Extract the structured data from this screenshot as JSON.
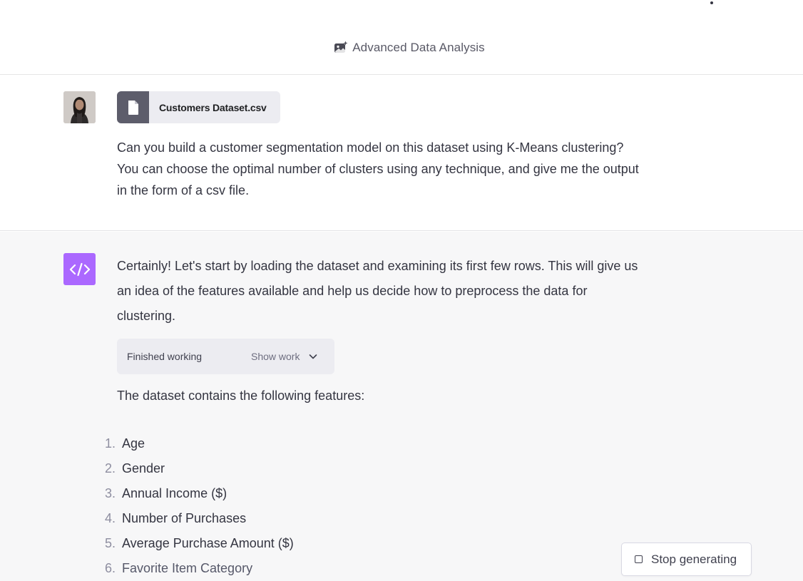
{
  "header": {
    "model_icon": "sparkle-image-icon",
    "model_name": "Advanced Data Analysis"
  },
  "user_turn": {
    "avatar": "user-avatar",
    "attachment": {
      "icon": "file-icon",
      "name": "Customers Dataset.csv"
    },
    "message_lines": [
      "Can you build a customer segmentation model on this dataset using K-Means clustering?",
      "You can choose the optimal number of clusters using any technique, and give me the output",
      "in the form of a csv file."
    ]
  },
  "assistant_turn": {
    "avatar_icon": "code-brackets-icon",
    "avatar_color": "#ab68ff",
    "intro_lines": [
      "Certainly! Let's start by loading the dataset and examining its first few rows. This will give us",
      "an idea of the features available and help us decide how to preprocess the data for",
      "clustering."
    ],
    "work_box": {
      "status": "Finished working",
      "toggle_label": "Show work",
      "toggle_icon": "chevron-down-icon"
    },
    "features_heading": "The dataset contains the following features:",
    "features": [
      {
        "num": "1.",
        "label": "Age"
      },
      {
        "num": "2.",
        "label": "Gender"
      },
      {
        "num": "3.",
        "label": "Annual Income ($)"
      },
      {
        "num": "4.",
        "label": "Number of Purchases"
      },
      {
        "num": "5.",
        "label": "Average Purchase Amount ($)"
      },
      {
        "num": "6.",
        "label": "Favorite Item Category"
      }
    ]
  },
  "controls": {
    "stop_label": "Stop generating",
    "stop_icon": "stop-square-icon"
  },
  "colors": {
    "assistant_bg": "#f7f7f8",
    "accent": "#ab68ff",
    "text": "#343541"
  }
}
